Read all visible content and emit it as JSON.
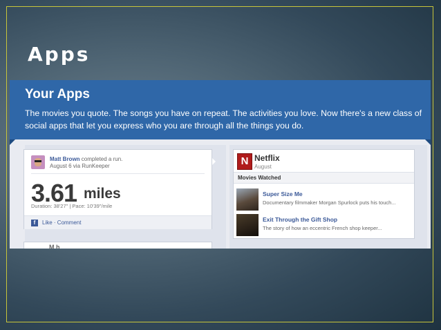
{
  "slide": {
    "title": "Apps"
  },
  "banner": {
    "title": "Your Apps",
    "text": "The movies you quote. The songs you have on repeat. The activities you love. Now there's a new class of social apps that let you express who you are through all the things you do."
  },
  "run_post": {
    "user": "Matt Brown",
    "action": "completed a run.",
    "meta": "August 6 via RunKeeper",
    "distance": "3.61",
    "unit": "miles",
    "stats": "Duration: 38'27\" | Pace: 10'39\"/mile",
    "fb_icon": "f",
    "actions": "Like · Comment"
  },
  "netflix": {
    "logo": "N",
    "name": "Netflix",
    "month": "August",
    "section": "Movies Watched",
    "movies": [
      {
        "title": "Super Size Me",
        "desc": "Documentary filmmaker Morgan Spurlock puts his touch..."
      },
      {
        "title": "Exit Through the Gift Shop",
        "desc": "The story of how an eccentric French shop keeper..."
      }
    ]
  },
  "next_post": {
    "partial": "M  h"
  },
  "colors": {
    "banner": "#2f67a8",
    "link": "#3b5998",
    "netflix": "#b01c1c",
    "frame": "#c9c63a"
  }
}
